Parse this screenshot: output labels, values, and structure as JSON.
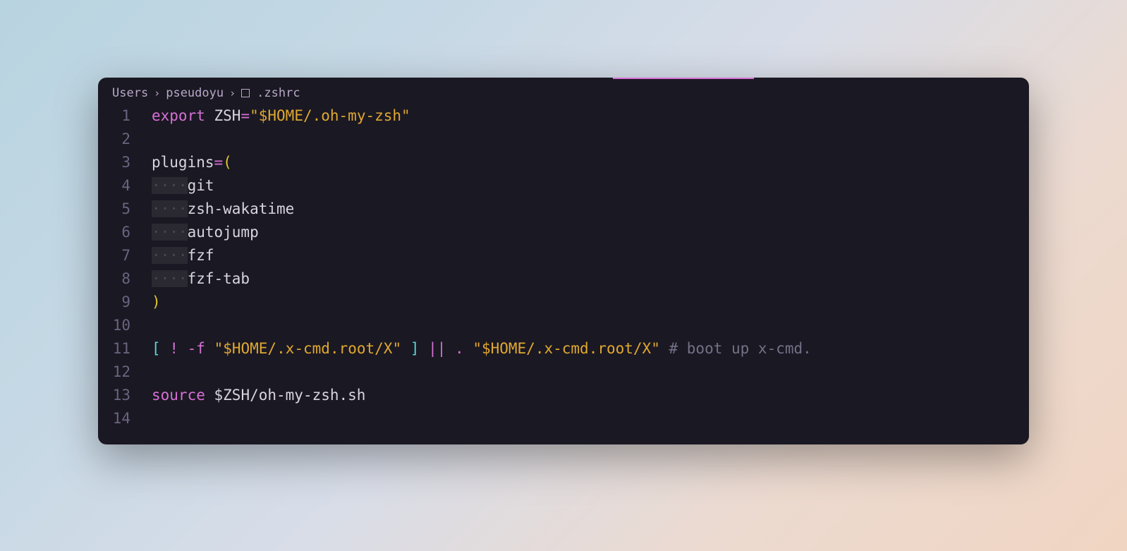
{
  "breadcrumb": {
    "parts": [
      "Users",
      "pseudoyu",
      ".zshrc"
    ]
  },
  "lines": [
    {
      "num": "1",
      "tokens": [
        {
          "cls": "tok-keyword",
          "text": "export"
        },
        {
          "cls": "tok-plain",
          "text": " "
        },
        {
          "cls": "tok-var",
          "text": "ZSH"
        },
        {
          "cls": "tok-op",
          "text": "="
        },
        {
          "cls": "tok-string",
          "text": "\"$HOME/.oh-my-zsh\""
        }
      ]
    },
    {
      "num": "2",
      "tokens": []
    },
    {
      "num": "3",
      "tokens": [
        {
          "cls": "tok-var",
          "text": "plugins"
        },
        {
          "cls": "tok-op",
          "text": "="
        },
        {
          "cls": "tok-paren",
          "text": "("
        }
      ]
    },
    {
      "num": "4",
      "tokens": [
        {
          "cls": "whitespace-dots",
          "text": "····"
        },
        {
          "cls": "tok-plugin",
          "text": "git"
        }
      ]
    },
    {
      "num": "5",
      "tokens": [
        {
          "cls": "whitespace-dots",
          "text": "····"
        },
        {
          "cls": "tok-plugin",
          "text": "zsh-wakatime"
        }
      ]
    },
    {
      "num": "6",
      "tokens": [
        {
          "cls": "whitespace-dots",
          "text": "····"
        },
        {
          "cls": "tok-plugin",
          "text": "autojump"
        }
      ]
    },
    {
      "num": "7",
      "tokens": [
        {
          "cls": "whitespace-dots",
          "text": "····"
        },
        {
          "cls": "tok-plugin",
          "text": "fzf"
        }
      ]
    },
    {
      "num": "8",
      "tokens": [
        {
          "cls": "whitespace-dots",
          "text": "····"
        },
        {
          "cls": "tok-plugin",
          "text": "fzf-tab"
        }
      ]
    },
    {
      "num": "9",
      "tokens": [
        {
          "cls": "tok-paren",
          "text": ")"
        }
      ]
    },
    {
      "num": "10",
      "tokens": []
    },
    {
      "num": "11",
      "tokens": [
        {
          "cls": "tok-bracket",
          "text": "["
        },
        {
          "cls": "tok-plain",
          "text": " "
        },
        {
          "cls": "tok-bang",
          "text": "!"
        },
        {
          "cls": "tok-plain",
          "text": " "
        },
        {
          "cls": "tok-flag",
          "text": "-f"
        },
        {
          "cls": "tok-plain",
          "text": " "
        },
        {
          "cls": "tok-string",
          "text": "\"$HOME/.x-cmd.root/X\""
        },
        {
          "cls": "tok-plain",
          "text": " "
        },
        {
          "cls": "tok-bracket",
          "text": "]"
        },
        {
          "cls": "tok-plain",
          "text": " "
        },
        {
          "cls": "tok-pipe",
          "text": "||"
        },
        {
          "cls": "tok-plain",
          "text": " "
        },
        {
          "cls": "tok-builtin",
          "text": "."
        },
        {
          "cls": "tok-plain",
          "text": " "
        },
        {
          "cls": "tok-string",
          "text": "\"$HOME/.x-cmd.root/X\""
        },
        {
          "cls": "tok-plain",
          "text": " "
        },
        {
          "cls": "tok-comment",
          "text": "# boot up x-cmd."
        }
      ]
    },
    {
      "num": "12",
      "tokens": []
    },
    {
      "num": "13",
      "tokens": [
        {
          "cls": "tok-builtin",
          "text": "source"
        },
        {
          "cls": "tok-plain",
          "text": " "
        },
        {
          "cls": "tok-var",
          "text": "$ZSH"
        },
        {
          "cls": "tok-plain",
          "text": "/oh-my-zsh.sh"
        }
      ]
    },
    {
      "num": "14",
      "tokens": []
    }
  ]
}
